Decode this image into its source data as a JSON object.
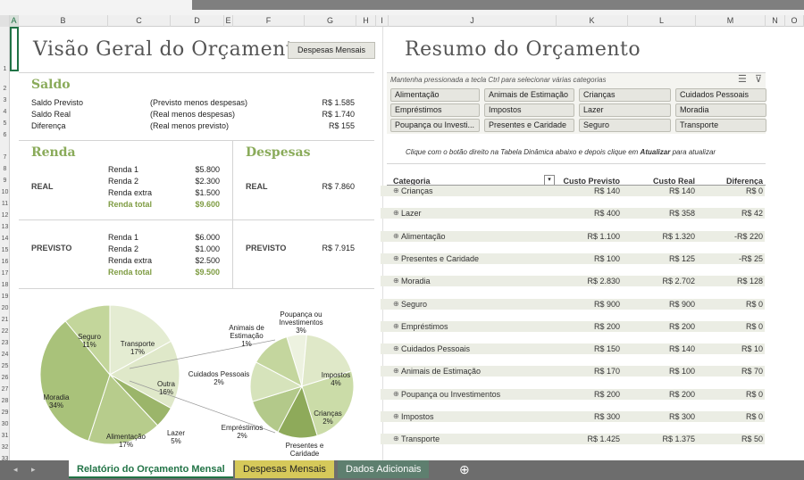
{
  "columns": [
    "A",
    "B",
    "C",
    "D",
    "E",
    "F",
    "G",
    "H",
    "I",
    "J",
    "K",
    "L",
    "M",
    "N",
    "O"
  ],
  "rows": [
    "1",
    "2",
    "3",
    "4",
    "5",
    "6",
    "7",
    "8",
    "9",
    "10",
    "11",
    "12",
    "13",
    "14",
    "15",
    "16",
    "17",
    "18",
    "19",
    "20",
    "21",
    "22",
    "23",
    "24",
    "25",
    "26",
    "27",
    "28",
    "29",
    "30",
    "31",
    "32",
    "33"
  ],
  "overview": {
    "title": "Visão Geral do Orçamento",
    "button": "Despesas Mensais"
  },
  "saldo": {
    "title": "Saldo",
    "rows": [
      {
        "label": "Saldo Previsto",
        "note": "(Previsto menos despesas)",
        "value": "R$ 1.585"
      },
      {
        "label": "Saldo Real",
        "note": "(Real menos despesas)",
        "value": "R$ 1.740"
      },
      {
        "label": "Diferença",
        "note": "(Real menos previsto)",
        "value": "R$ 155"
      }
    ]
  },
  "renda": {
    "title": "Renda",
    "real": {
      "label": "REAL",
      "items": [
        {
          "name": "Renda 1",
          "value": "$5.800"
        },
        {
          "name": "Renda 2",
          "value": "$2.300"
        },
        {
          "name": "Renda extra",
          "value": "$1.500"
        }
      ],
      "total_label": "Renda total",
      "total": "$9.600"
    },
    "previsto": {
      "label": "PREVISTO",
      "items": [
        {
          "name": "Renda 1",
          "value": "$6.000"
        },
        {
          "name": "Renda 2",
          "value": "$1.000"
        },
        {
          "name": "Renda extra",
          "value": "$2.500"
        }
      ],
      "total_label": "Renda total",
      "total": "$9.500"
    }
  },
  "despesas": {
    "title": "Despesas",
    "real_label": "REAL",
    "real_value": "R$ 7.860",
    "previsto_label": "PREVISTO",
    "previsto_value": "R$ 7.915"
  },
  "chart_data": {
    "type": "pie",
    "title": "",
    "slices": [
      {
        "label": "Seguro",
        "value": 11
      },
      {
        "label": "Transporte",
        "value": 17
      },
      {
        "label": "Outra",
        "value": 16
      },
      {
        "label": "Lazer",
        "value": 5
      },
      {
        "label": "Alimentação",
        "value": 17
      },
      {
        "label": "Moradia",
        "value": 34
      }
    ],
    "secondary": [
      {
        "label": "Animais de Estimação",
        "value": 1
      },
      {
        "label": "Poupança ou Investimentos",
        "value": 3
      },
      {
        "label": "Impostos",
        "value": 4
      },
      {
        "label": "Crianças",
        "value": 2
      },
      {
        "label": "Presentes e Caridade",
        "value": 2
      },
      {
        "label": "Empréstimos",
        "value": 2
      },
      {
        "label": "Cuidados Pessoais",
        "value": 2
      }
    ],
    "labels": {
      "seguro": "Seguro\n11%",
      "transporte": "Transporte\n17%",
      "outra": "Outra\n16%",
      "lazer": "Lazer\n5%",
      "alimentacao": "Alimentação\n17%",
      "moradia": "Moradia\n34%",
      "animais": "Animais de\nEstimação\n1%",
      "poupanca": "Poupança ou\nInvestimentos\n3%",
      "impostos": "Impostos\n4%",
      "criancas": "Crianças\n2%",
      "presentes": "Presentes e\nCaridade",
      "emprestimos": "Empréstimos\n2%",
      "cuidados": "Cuidados Pessoais\n2%"
    }
  },
  "summary": {
    "title": "Resumo do Orçamento",
    "hint": "Mantenha pressionada a tecla Ctrl para selecionar várias categorias",
    "slicers": [
      "Alimentação",
      "Animais de Estimação",
      "Crianças",
      "Cuidados Pessoais",
      "Empréstimos",
      "Impostos",
      "Lazer",
      "Moradia",
      "Poupança ou Investi...",
      "Presentes e Caridade",
      "Seguro",
      "Transporte"
    ],
    "refresh_hint": "Clique com o botão direito na Tabela Dinâmica abaixo e depois clique em",
    "refresh_word": "Atualizar",
    "refresh_tail": "para atualizar",
    "table": {
      "headers": [
        "Categoria",
        "Custo Previsto",
        "Custo Real",
        "Diferença"
      ],
      "rows": [
        [
          "Crianças",
          "R$ 140",
          "R$ 140",
          "R$ 0"
        ],
        [
          "Lazer",
          "R$ 400",
          "R$ 358",
          "R$ 42"
        ],
        [
          "Alimentação",
          "R$ 1.100",
          "R$ 1.320",
          "-R$ 220"
        ],
        [
          "Presentes e Caridade",
          "R$ 100",
          "R$ 125",
          "-R$ 25"
        ],
        [
          "Moradia",
          "R$ 2.830",
          "R$ 2.702",
          "R$ 128"
        ],
        [
          "Seguro",
          "R$ 900",
          "R$ 900",
          "R$ 0"
        ],
        [
          "Empréstimos",
          "R$ 200",
          "R$ 200",
          "R$ 0"
        ],
        [
          "Cuidados Pessoais",
          "R$ 150",
          "R$ 140",
          "R$ 10"
        ],
        [
          "Animais de Estimação",
          "R$ 170",
          "R$ 100",
          "R$ 70"
        ],
        [
          "Poupança ou Investimentos",
          "R$ 200",
          "R$ 200",
          "R$ 0"
        ],
        [
          "Impostos",
          "R$ 300",
          "R$ 300",
          "R$ 0"
        ],
        [
          "Transporte",
          "R$ 1.425",
          "R$ 1.375",
          "R$ 50"
        ]
      ]
    }
  },
  "tabs": [
    {
      "label": "Relatório do Orçamento Mensal",
      "color": "#ffffff",
      "text": "#217346"
    },
    {
      "label": "Despesas Mensais",
      "color": "#d6c95a",
      "text": "#222222"
    },
    {
      "label": "Dados Adicionais",
      "color": "#5e7f6f",
      "text": "#ffffff"
    }
  ],
  "tab_add": "⊕",
  "nav_prev": "◂",
  "nav_next": "▸"
}
